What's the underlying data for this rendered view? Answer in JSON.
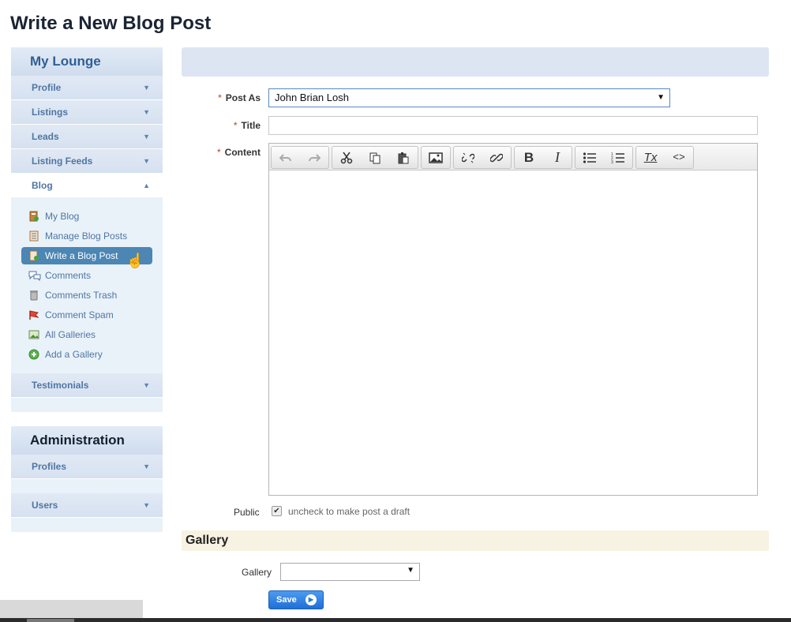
{
  "page": {
    "title": "Write a New Blog Post"
  },
  "sidebar": {
    "lounge_title": "My Lounge",
    "items": [
      {
        "label": "Profile",
        "arrow": "▼"
      },
      {
        "label": "Listings",
        "arrow": "▼"
      },
      {
        "label": "Leads",
        "arrow": "▼"
      },
      {
        "label": "Listing Feeds",
        "arrow": "▼"
      },
      {
        "label": "Blog",
        "arrow": "▲"
      }
    ],
    "blog_sub": [
      {
        "label": "My Blog",
        "icon": "blog-book-icon"
      },
      {
        "label": "Manage Blog Posts",
        "icon": "document-list-icon"
      },
      {
        "label": "Write a Blog Post",
        "icon": "write-post-icon"
      },
      {
        "label": "Comments",
        "icon": "comment-bubbles-icon"
      },
      {
        "label": "Comments Trash",
        "icon": "trash-can-icon"
      },
      {
        "label": "Comment Spam",
        "icon": "spam-flag-icon"
      },
      {
        "label": "All Galleries",
        "icon": "picture-icon"
      },
      {
        "label": "Add a Gallery",
        "icon": "add-circle-icon"
      }
    ],
    "testimonials": {
      "label": "Testimonials",
      "arrow": "▼"
    },
    "admin_title": "Administration",
    "admin_items": [
      {
        "label": "Profiles",
        "arrow": "▼"
      },
      {
        "label": "Users",
        "arrow": "▼"
      }
    ]
  },
  "form": {
    "required_mark": "*",
    "post_as": {
      "label": "Post As",
      "value": "John Brian Losh",
      "caret": "▼"
    },
    "title": {
      "label": "Title",
      "value": ""
    },
    "content": {
      "label": "Content"
    },
    "public": {
      "label": "Public",
      "checked": true,
      "check_glyph": "✔",
      "hint": "uncheck to make post a draft"
    }
  },
  "toolbar": {
    "buttons": [
      "undo-icon",
      "redo-icon",
      "cut-icon",
      "copy-icon",
      "paste-icon",
      "image-icon",
      "unlink-icon",
      "link-icon",
      "bold-icon",
      "italic-icon",
      "bulleted-list-icon",
      "numbered-list-icon",
      "remove-format-icon",
      "source-code-icon"
    ],
    "bold_glyph": "B",
    "italic_glyph": "I",
    "clear_glyph": "Tx",
    "source_glyph": "<>"
  },
  "gallery": {
    "section_title": "Gallery",
    "label": "Gallery",
    "value": "",
    "caret": "▼"
  },
  "actions": {
    "save_label": "Save",
    "save_icon": "▶"
  },
  "colors": {
    "accent": "#4b86b4",
    "sidebar_bg": "#e9f2f9",
    "header_bar": "#dde5f2",
    "gallery_bar": "#f8f2e2",
    "save_button": "#2a76da",
    "required": "#c0392b"
  }
}
